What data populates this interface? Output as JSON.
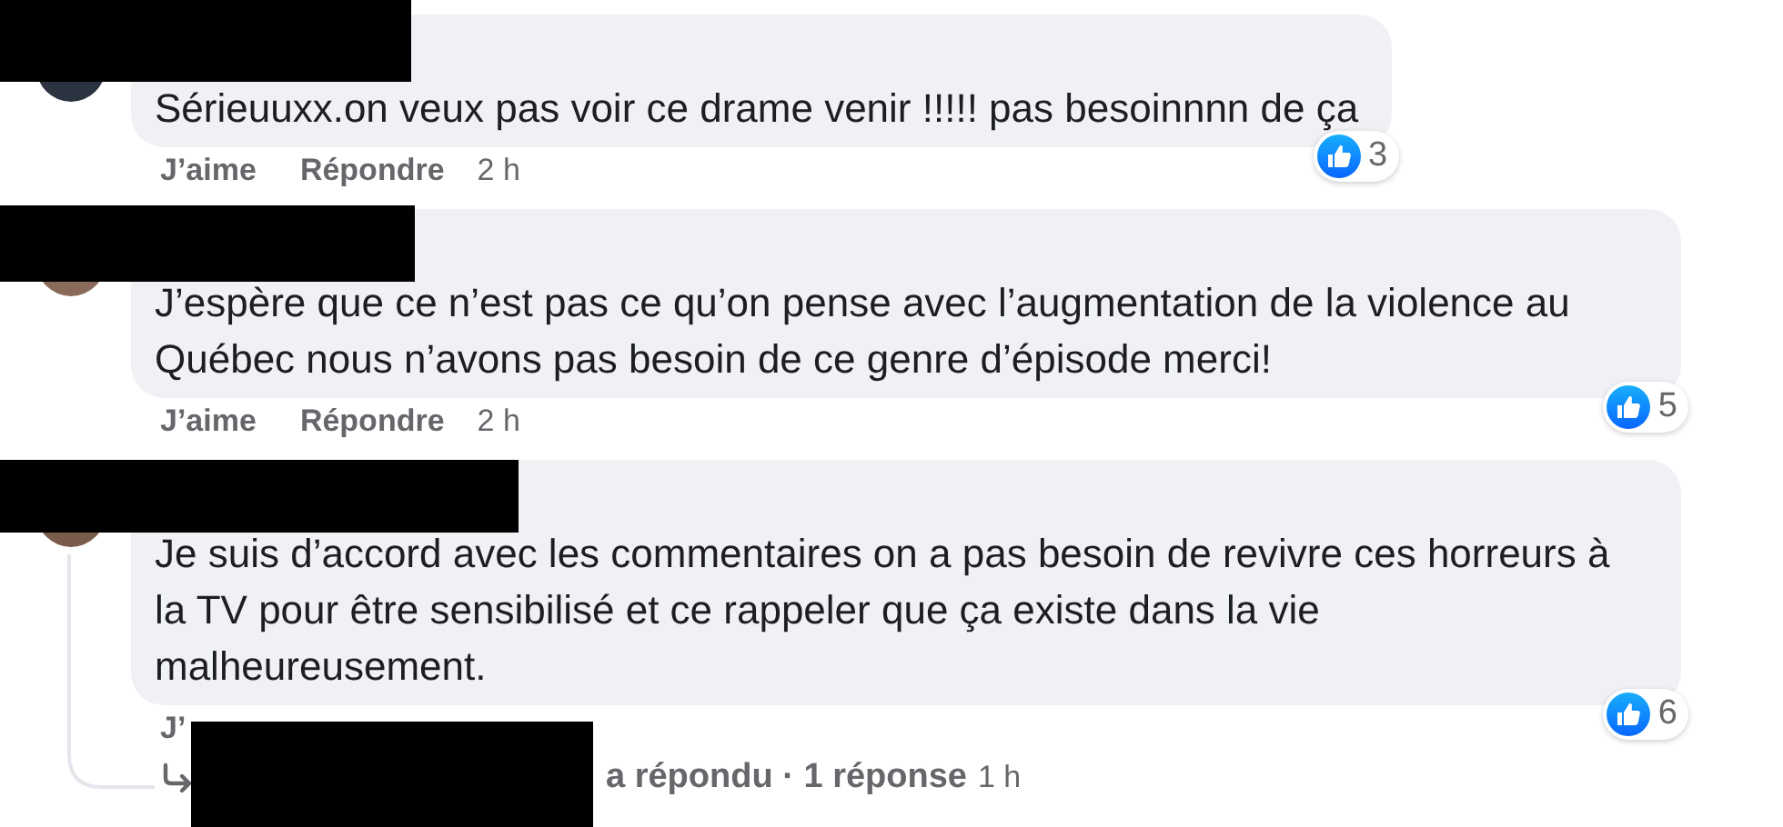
{
  "comments": [
    {
      "text": "Sérieuuxx.on veux pas voir ce drame venir !!!!! pas besoinnnn de ça",
      "actions": [
        "J’aime",
        "Répondre"
      ],
      "time": "2 h",
      "reactions": "3"
    },
    {
      "text": "J’espère que ce n’est pas ce qu’on pense avec l’augmentation de la violence au Québec nous n’avons pas besoin de ce genre d’épisode merci!",
      "actions": [
        "J’aime",
        "Répondre"
      ],
      "time": "2 h",
      "reactions": "5"
    },
    {
      "text": "Je suis d’accord avec les commentaires on a pas besoin de revivre ces horreurs à la TV pour être sensibilisé et ce rappeler que ça existe dans la vie malheureusement.",
      "actions": [
        "J’"
      ],
      "reactions": "6"
    }
  ],
  "reply_summary": {
    "text": "a répondu · 1 réponse",
    "time": "1 h"
  }
}
